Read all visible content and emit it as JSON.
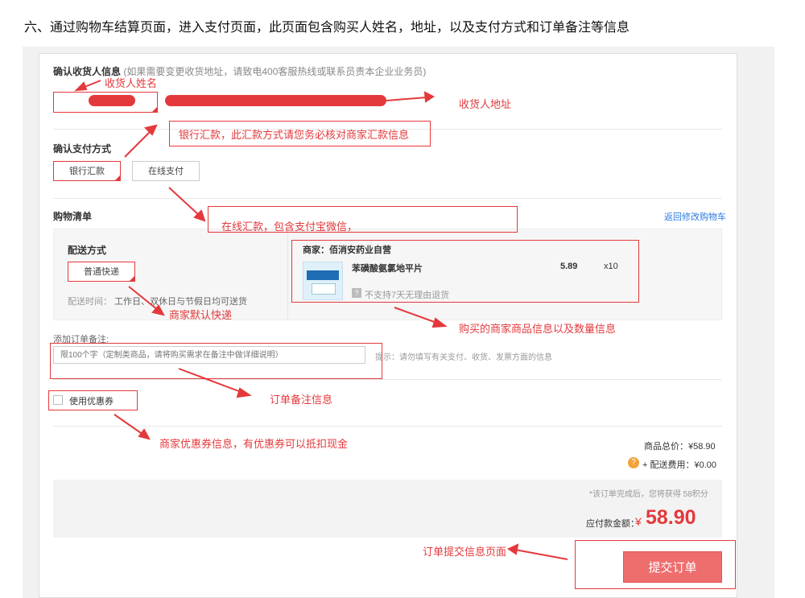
{
  "heading": "六、通过购物车结算页面，进入支付页面，此页面包含购买人姓名，地址，以及支付方式和订单备注等信息",
  "consignee": {
    "title": "确认收货人信息",
    "note": "(如果需要变更收货地址，请致电400客服热线或联系员责本企业业务员)"
  },
  "payment": {
    "title": "确认支付方式",
    "options": [
      "银行汇款",
      "在线支付"
    ],
    "selected": "银行汇款"
  },
  "cart": {
    "title": "购物清单",
    "back_link": "返回修改购物车",
    "delivery_title": "配送方式",
    "delivery_option": "普通快递",
    "delivery_time_label": "配送时间：",
    "delivery_time": "工作日、双休日与节假日均可送货",
    "seller": "商家：佰消安药业自营",
    "product_name": "苯磺酸氨氯地平片",
    "price": "5.89",
    "qty": "x10",
    "return_badge": "?",
    "return_note": "不支持7天无理由退货"
  },
  "remark": {
    "label": "添加订单备注:",
    "placeholder": "限100个字（定制类商品，请将购买需求在备注中做详细说明）",
    "hint": "提示：请勿填写有关支付、收货、发票方面的信息"
  },
  "coupon": {
    "label": "使用优惠券"
  },
  "totals": {
    "goods_total_label": "商品总价：",
    "goods_total": "¥58.90",
    "shipping_badge": "?",
    "shipping_label": "+ 配送费用：",
    "shipping": "¥0.00",
    "points_note": "*该订单完成后，您将获得 58积分",
    "payable_label": "应付款金额：",
    "payable_currency": "¥",
    "payable_amount": "58.90",
    "submit_label": "提交订单"
  },
  "annotations": {
    "name": "收货人姓名",
    "address": "收货人地址",
    "bank": "银行汇款，此汇款方式请您务必核对商家汇款信息",
    "online": "在线汇款，包含支付宝微信，",
    "default_express": "商家默认快递",
    "product_info": "购买的商家商品信息以及数量信息",
    "remark_info": "订单备注信息",
    "coupon_info": "商家优惠券信息，有优惠券可以抵扣现金",
    "submit_info": "订单提交信息页面"
  },
  "colors": {
    "accent": "#e4393c",
    "submit_bg": "#ee6e6e",
    "link": "#2a7ae2"
  }
}
